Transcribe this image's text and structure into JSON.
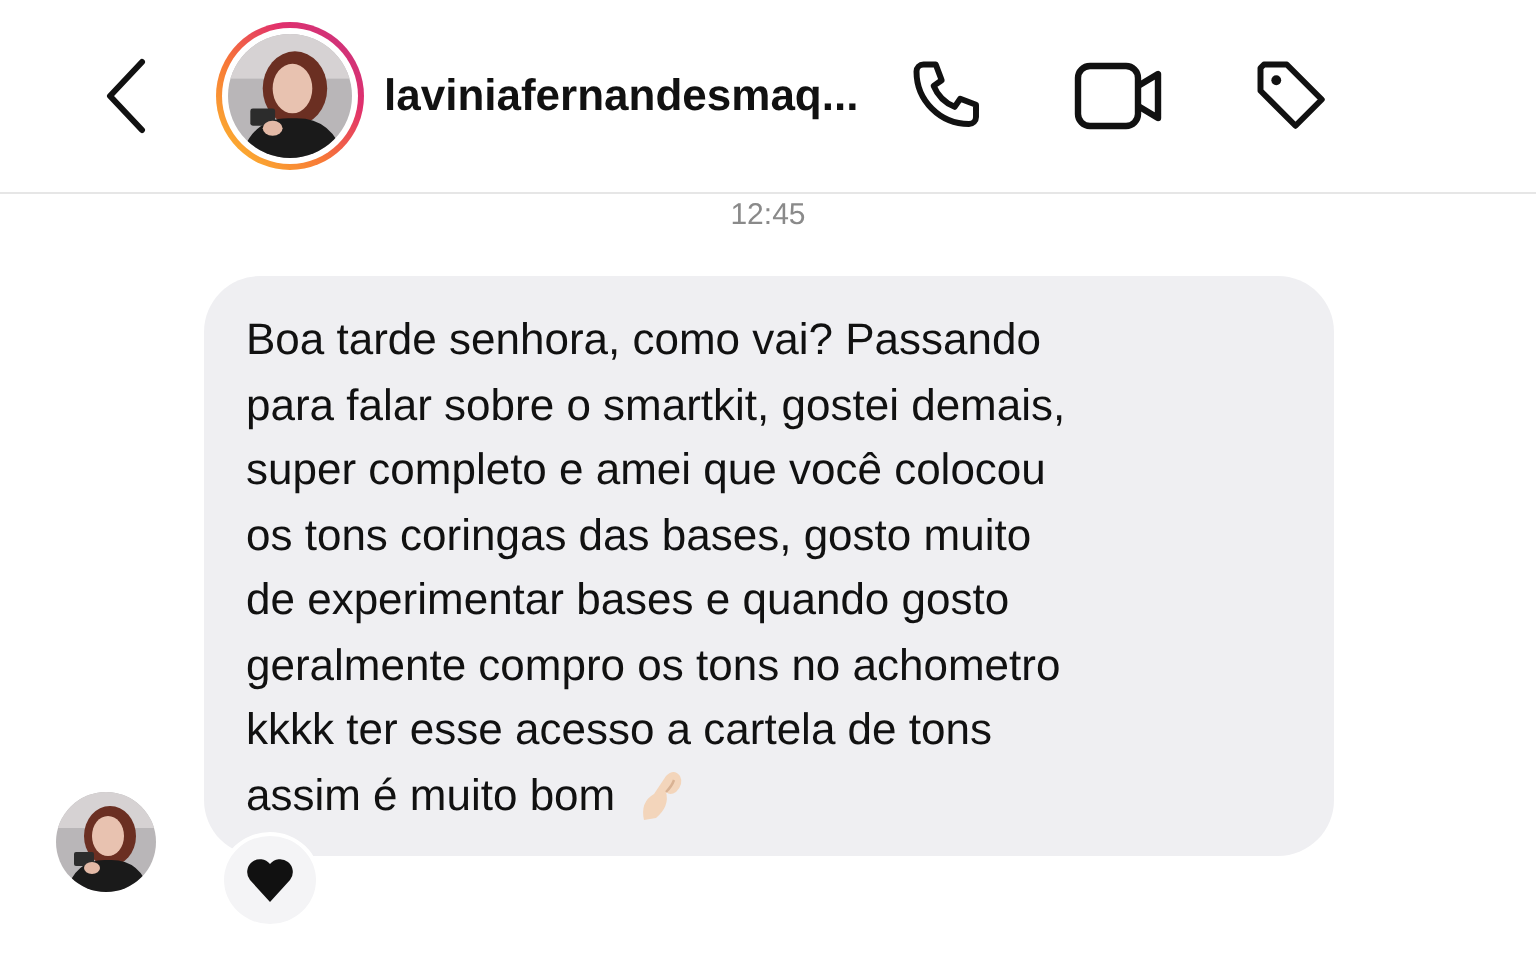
{
  "header": {
    "username": "laviniafernandesmaq...",
    "avatar": {
      "kind": "picture",
      "story_ring": true
    }
  },
  "messages": [
    {
      "time": "12:45",
      "text": "Boa tarde senhora, como vai? Passando\npara falar sobre o smartkit, gostei demais,\nsuper completo e amei que você colocou\nos tons coringas das bases, gosto muito\nde experimentar bases e quando gosto\ngeralmente compro os tons no achometro\nkkkk ter esse acesso a cartela de tons\nassim é muito bom",
      "reaction": true
    }
  ]
}
